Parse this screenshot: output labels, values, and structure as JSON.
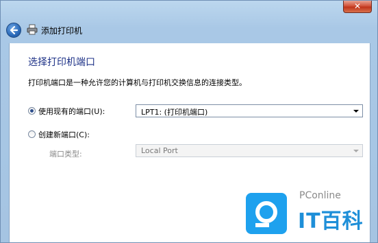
{
  "window": {
    "title": "添加打印机",
    "close_glyph": "✕"
  },
  "page": {
    "heading": "选择打印机端口",
    "description": "打印机端口是一种允许您的计算机与打印机交换信息的连接类型。"
  },
  "options": {
    "use_existing": {
      "label": "使用现有的端口(U):",
      "selected": true,
      "value": "LPT1: (打印机端口)"
    },
    "create_new": {
      "label": "创建新端口(C):",
      "selected": false,
      "port_type_label": "端口类型:",
      "port_type_value": "Local Port"
    }
  },
  "watermark": {
    "brand_small": "PConline",
    "brand_big": "IT百科"
  },
  "icons": [
    "back-arrow-icon",
    "printer-icon",
    "close-icon",
    "chevron-down-icon",
    "pconline-logo-icon"
  ]
}
